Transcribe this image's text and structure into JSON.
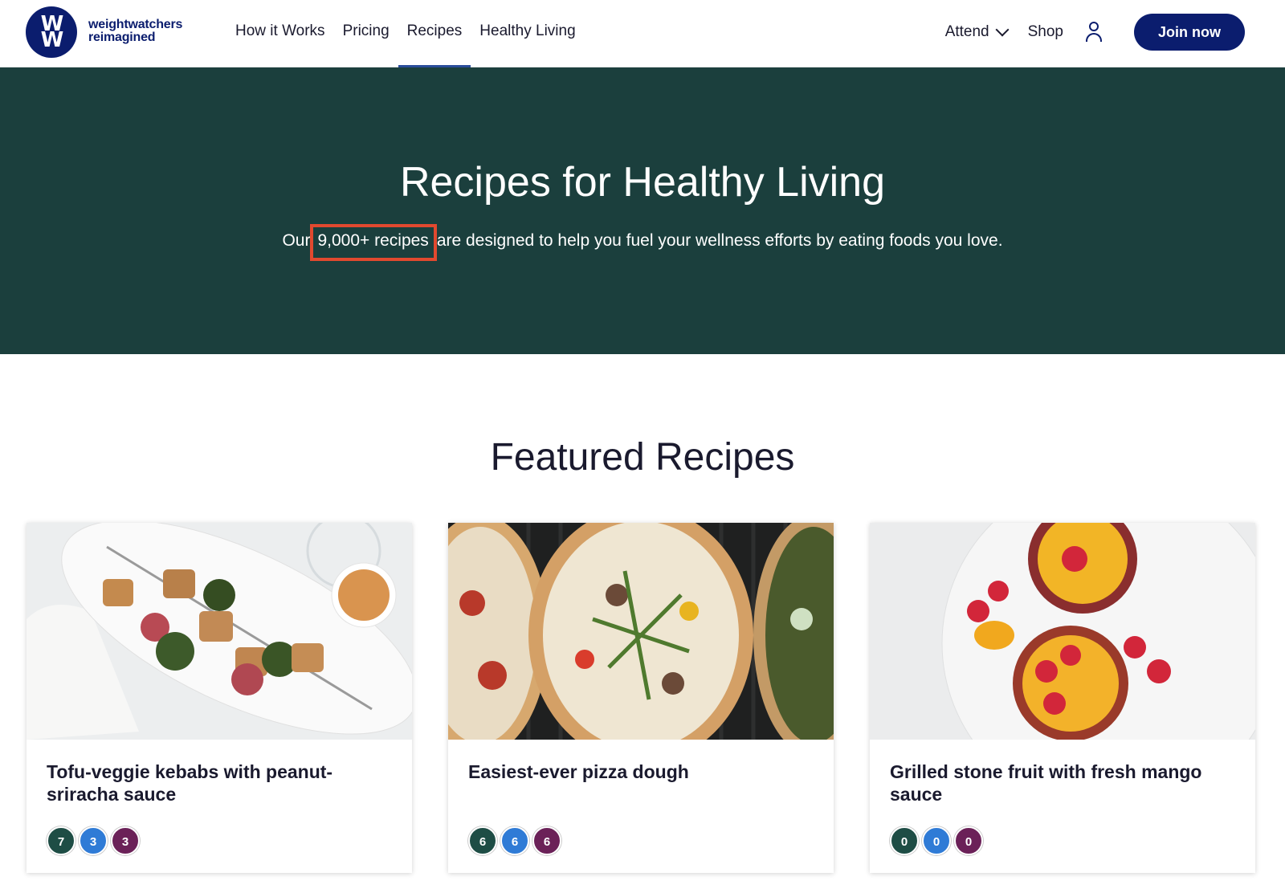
{
  "header": {
    "logo_line1": "W",
    "logo_line2": "W",
    "brand_line1": "weightwatchers",
    "brand_line2": "reimagined",
    "nav": [
      {
        "label": "How it Works",
        "active": false
      },
      {
        "label": "Pricing",
        "active": false
      },
      {
        "label": "Recipes",
        "active": true
      },
      {
        "label": "Healthy Living",
        "active": false
      }
    ],
    "attend_label": "Attend",
    "shop_label": "Shop",
    "join_label": "Join now"
  },
  "hero": {
    "title": "Recipes for Healthy Living",
    "subtitle_before": "Our",
    "subtitle_highlight": "9,000+ recipes",
    "subtitle_after": "are designed to help you fuel your wellness efforts by eating foods you love."
  },
  "featured": {
    "title": "Featured Recipes",
    "cards": [
      {
        "title": "Tofu-veggie kebabs with peanut-sriracha sauce",
        "points": [
          "7",
          "3",
          "3"
        ]
      },
      {
        "title": "Easiest-ever pizza dough",
        "points": [
          "6",
          "6",
          "6"
        ]
      },
      {
        "title": "Grilled stone fruit with fresh mango sauce",
        "points": [
          "0",
          "0",
          "0"
        ]
      }
    ]
  },
  "colors": {
    "brand_navy": "#0b1d6e",
    "hero_bg": "#1b3f3d",
    "highlight_border": "#e2492f",
    "badge_green": "#1e4d45",
    "badge_blue": "#2f7bd6",
    "badge_purple": "#6b2158"
  }
}
